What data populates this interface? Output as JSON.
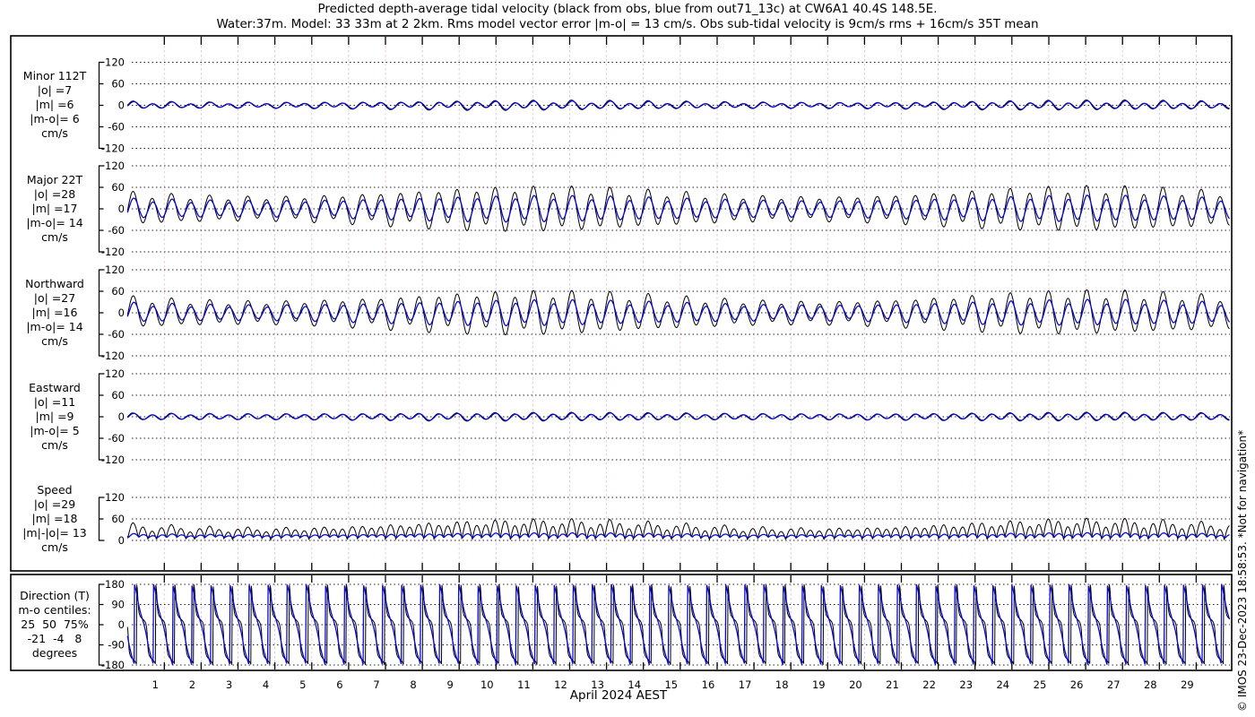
{
  "header": {
    "title_line1": "Predicted depth-average tidal velocity (black from obs, blue from out71_13c) at CW6A1 40.4S 148.5E.",
    "title_line2": "Water:37m. Model: 33 33m at 2 2km. Rms model vector error |m-o| = 13 cm/s. Obs sub-tidal velocity is 9cm/s rms + 16cm/s 35T mean"
  },
  "footer": {
    "xaxis_caption": "April 2024 AEST"
  },
  "credit_vertical": "© IMOS 23-Dec-2023 18:58:53. *Not for navigation*",
  "chart_data": {
    "type": "line",
    "x_axis": {
      "day_labels": [
        "1",
        "2",
        "3",
        "4",
        "5",
        "6",
        "7",
        "8",
        "9",
        "10",
        "11",
        "12",
        "13",
        "14",
        "15",
        "16",
        "17",
        "18",
        "19",
        "20",
        "21",
        "22",
        "23",
        "24",
        "25",
        "26",
        "27",
        "28",
        "29"
      ],
      "days_shown": 30,
      "caption": "April 2024 AEST"
    },
    "legend": {
      "obs_label": "black from obs",
      "model_label": "blue from out71_13c",
      "obs_color": "#000000",
      "model_color": "#0a0acd"
    },
    "grid": {
      "h_dot_color": "#222222",
      "day_line_odd": "#e9c7c7",
      "day_line_even": "#c7c7e9"
    },
    "tide_model": {
      "semidiurnal_period_days": 0.5175,
      "diurnal_period_days": 1.0758,
      "spring_neap_period_days": 15,
      "spring_peak_day": 11
    },
    "panels": [
      {
        "id": "minor",
        "kind": "velocity",
        "units": "cm/s",
        "label_lines": [
          "Minor 112T",
          "|o| =7",
          "|m| =6",
          "|m-o|= 6",
          "cm/s"
        ],
        "ylim": [
          -120,
          120
        ],
        "yticks": [
          120,
          60,
          0,
          -60,
          -120
        ],
        "obs": {
          "amp_mean": 8.5,
          "amp_mod": 2.0,
          "diurnal": 0.45,
          "phase": -0.3
        },
        "model": {
          "amp_mean": 7.5,
          "amp_mod": 1.5,
          "diurnal": 0.4,
          "phase": -0.55
        }
      },
      {
        "id": "major",
        "kind": "velocity",
        "units": "cm/s",
        "label_lines": [
          "Major 22T",
          "|o| =28",
          "|m| =17",
          "|m-o|= 14",
          "cm/s"
        ],
        "ylim": [
          -120,
          120
        ],
        "yticks": [
          120,
          60,
          0,
          -60,
          -120
        ],
        "obs": {
          "amp_mean": 42,
          "amp_mod": 12,
          "diurnal": 0.22,
          "phase": -0.3
        },
        "model": {
          "amp_mean": 26,
          "amp_mod": 6,
          "diurnal": 0.2,
          "phase": -0.55
        }
      },
      {
        "id": "north",
        "kind": "velocity",
        "units": "cm/s",
        "label_lines": [
          "Northward",
          "|o| =27",
          "|m| =16",
          "|m-o|= 14",
          "cm/s"
        ],
        "ylim": [
          -120,
          120
        ],
        "yticks": [
          120,
          60,
          0,
          -60,
          -120
        ],
        "obs": {
          "amp_mean": 40,
          "amp_mod": 12,
          "diurnal": 0.25,
          "phase": -0.35
        },
        "model": {
          "amp_mean": 25,
          "amp_mod": 6,
          "diurnal": 0.22,
          "phase": -0.6
        }
      },
      {
        "id": "east",
        "kind": "velocity",
        "units": "cm/s",
        "label_lines": [
          "Eastward",
          "|o| =11",
          "|m| =9",
          "|m-o|= 5",
          "cm/s"
        ],
        "ylim": [
          -120,
          120
        ],
        "yticks": [
          120,
          60,
          0,
          -60,
          -120
        ],
        "obs": {
          "amp_mean": 8.5,
          "amp_mod": 1.5,
          "diurnal": 0.3,
          "phase": -0.25
        },
        "model": {
          "amp_mean": 7.5,
          "amp_mod": 1.0,
          "diurnal": 0.28,
          "phase": -0.5
        }
      },
      {
        "id": "speed",
        "kind": "speed",
        "units": "cm/s",
        "label_lines": [
          "Speed",
          "|o| =29",
          "|m| =18",
          "|m|-|o|= 13",
          "cm/s"
        ],
        "ylim": [
          0,
          130
        ],
        "yticks": [
          120,
          60,
          0
        ],
        "obs": {
          "base": 5.5,
          "scale": 0.82,
          "diurnal_amp": 3.5
        },
        "model": {
          "base": 8.2,
          "scale": 0.32,
          "diurnal_amp": 1.2
        }
      },
      {
        "id": "direction",
        "kind": "direction",
        "units": "degrees",
        "label_lines": [
          "Direction (T)",
          "m-o centiles:",
          "25  50  75%",
          "-21  -4   8",
          "degrees"
        ],
        "ylim": [
          -180,
          180
        ],
        "yticks": [
          180,
          90,
          0,
          -90,
          -180
        ],
        "obs": {
          "ellipticity": 0.22,
          "bearing_offset_deg": -65,
          "phase": -0.3
        },
        "model": {
          "ellipticity": 0.78,
          "bearing_offset_deg": -65,
          "phase": -0.2
        }
      }
    ]
  }
}
